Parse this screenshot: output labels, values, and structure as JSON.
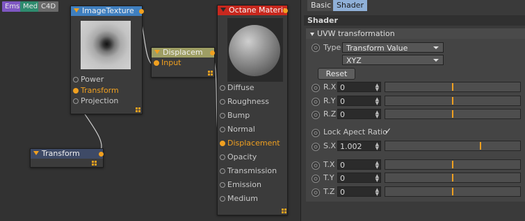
{
  "tags": [
    {
      "label": "Ems",
      "color": "#7e57c2"
    },
    {
      "label": "Med",
      "color": "#2e8b6e"
    },
    {
      "label": "C4D",
      "color": "#6a6a6a"
    }
  ],
  "nodes": {
    "image_texture": {
      "title": "ImageTexture",
      "header_color": "#3f7fbf",
      "inputs": [
        "Power",
        "Transform",
        "Projection"
      ]
    },
    "displacement": {
      "title": "Displacem",
      "header_color": "#9e9e64",
      "inputs": [
        "Input"
      ]
    },
    "transform": {
      "title": "Transform",
      "header_color": "#3e4a66"
    },
    "material": {
      "title": "Octane Material",
      "header_color": "#c8281e",
      "inputs": [
        "Diffuse",
        "Roughness",
        "Bump",
        "Normal",
        "Displacement",
        "Opacity",
        "Transmission",
        "Emission",
        "Medium"
      ],
      "active_input": "Displacement"
    }
  },
  "panel": {
    "tabs": [
      "Basic",
      "Shader"
    ],
    "active_tab": "Shader",
    "section_title": "Shader",
    "group_title": "UVW transformation",
    "type_label": "Type",
    "type_value": "Transform Value",
    "order_value": "XYZ",
    "reset_label": "Reset",
    "rotation": [
      {
        "label": "R.X",
        "value": "0",
        "fraction": 0.5
      },
      {
        "label": "R.Y",
        "value": "0",
        "fraction": 0.5
      },
      {
        "label": "R.Z",
        "value": "0",
        "fraction": 0.5
      }
    ],
    "lock_label": "Lock Apect Ratio",
    "lock_checked": true,
    "scale": [
      {
        "label": "S.X",
        "value": "1.002",
        "fraction": 0.71
      }
    ],
    "translation": [
      {
        "label": "T.X",
        "value": "0",
        "fraction": 0.5
      },
      {
        "label": "T.Y",
        "value": "0",
        "fraction": 0.5
      },
      {
        "label": "T.Z",
        "value": "0",
        "fraction": 0.5
      }
    ],
    "accent": "#f0a020"
  }
}
